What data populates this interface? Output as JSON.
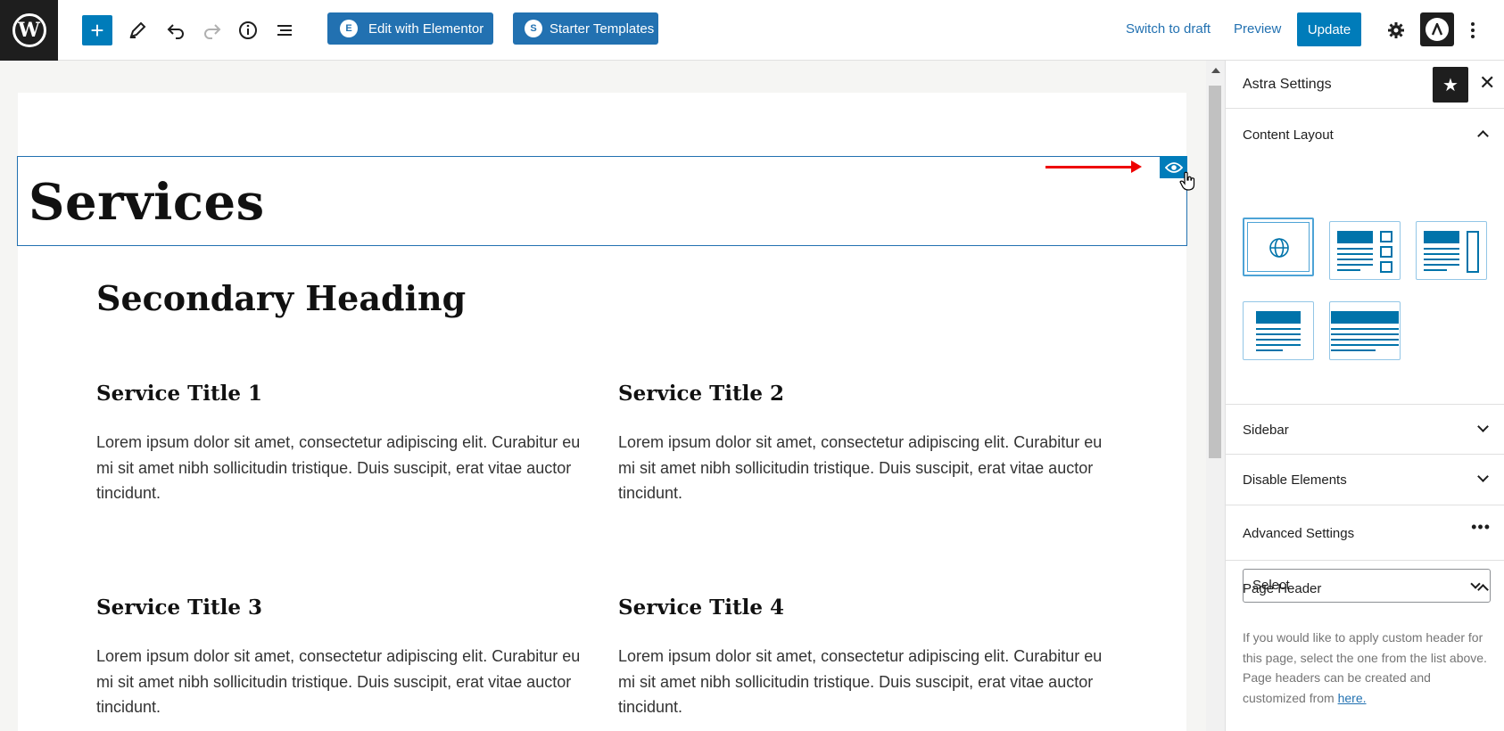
{
  "toolbar": {
    "edit_elementor_label": "Edit with Elementor",
    "elementor_icon_glyph": "E",
    "starter_templates_label": "Starter Templates",
    "starter_icon_glyph": "S",
    "switch_to_draft_label": "Switch to draft",
    "preview_label": "Preview",
    "update_label": "Update",
    "icons": [
      "wordpress-logo",
      "add-block-icon",
      "pencil-icon",
      "undo-icon",
      "redo-icon",
      "info-icon",
      "list-view-icon",
      "gear-icon",
      "astra-icon",
      "more-vertical-icon"
    ]
  },
  "editor": {
    "page_title": "Services",
    "secondary_heading": "Secondary Heading",
    "services": [
      {
        "title": "Service Title 1",
        "text": "Lorem ipsum dolor sit amet, consectetur adipiscing elit. Curabitur eu mi sit amet nibh sollicitudin tristique. Duis suscipit, erat vitae auctor tincidunt."
      },
      {
        "title": "Service Title 2",
        "text": "Lorem ipsum dolor sit amet, consectetur adipiscing elit. Curabitur eu mi sit amet nibh sollicitudin tristique. Duis suscipit, erat vitae auctor tincidunt."
      },
      {
        "title": "Service Title 3",
        "text": "Lorem ipsum dolor sit amet, consectetur adipiscing elit. Curabitur eu mi sit amet nibh sollicitudin tristique. Duis suscipit, erat vitae auctor tincidunt."
      },
      {
        "title": "Service Title 4",
        "text": "Lorem ipsum dolor sit amet, consectetur adipiscing elit. Curabitur eu mi sit amet nibh sollicitudin tristique. Duis suscipit, erat vitae auctor tincidunt."
      }
    ]
  },
  "sidebar": {
    "title": "Astra Settings",
    "content_layout_label": "Content Layout",
    "sidebar_label": "Sidebar",
    "disable_elements_label": "Disable Elements",
    "advanced_settings_label": "Advanced Settings",
    "page_header_label": "Page Header",
    "page_header_select_value": "Select",
    "help_text": "If you would like to apply custom header for this page, select the one from the list above. Page headers can be created and customized from",
    "help_link": "here."
  },
  "colors": {
    "accent": "#007cba",
    "dark": "#1e1e1e",
    "annotation_arrow": "#e00000"
  }
}
